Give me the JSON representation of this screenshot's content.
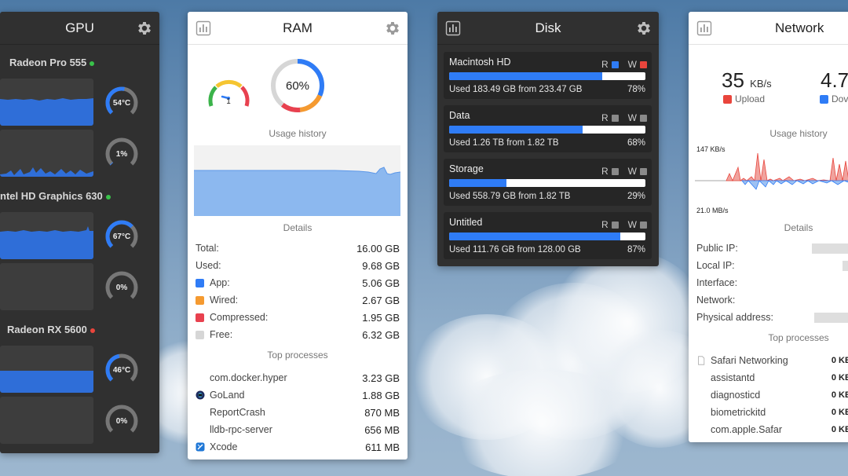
{
  "gpu": {
    "title": "GPU",
    "devices": [
      {
        "name": "Radeon Pro 555",
        "status_color": "#39c24a",
        "temp": "54°C",
        "usage": "1%",
        "temp_level": 0.54,
        "usage_level": 0.01
      },
      {
        "name": "ntel HD Graphics 630",
        "status_color": "#39c24a",
        "temp": "67°C",
        "usage": "0%",
        "temp_level": 0.67,
        "usage_level": 0.0
      },
      {
        "name": "Radeon RX 5600",
        "status_color": "#e9453c",
        "temp": "46°C",
        "usage": "0%",
        "temp_level": 0.46,
        "usage_level": 0.0
      }
    ]
  },
  "ram": {
    "title": "RAM",
    "pressure_value": "1",
    "usage_percent": "60%",
    "usage_level": 0.6,
    "history_title": "Usage history",
    "details_title": "Details",
    "details": [
      {
        "label": "Total:",
        "value": "16.00 GB"
      },
      {
        "label": "Used:",
        "value": "9.68 GB"
      },
      {
        "label": "App:",
        "value": "5.06 GB",
        "color": "#2f7cf6"
      },
      {
        "label": "Wired:",
        "value": "2.67 GB",
        "color": "#f59a30"
      },
      {
        "label": "Compressed:",
        "value": "1.95 GB",
        "color": "#e8414f"
      },
      {
        "label": "Free:",
        "value": "6.32 GB",
        "color": "#d6d6d6"
      }
    ],
    "processes_title": "Top processes",
    "processes": [
      {
        "name": "com.docker.hyper",
        "value": "3.23 GB",
        "icon": "blank"
      },
      {
        "name": "GoLand",
        "value": "1.88 GB",
        "icon": "goland-icon"
      },
      {
        "name": "ReportCrash",
        "value": "870 MB",
        "icon": "blank"
      },
      {
        "name": "lldb-rpc-server",
        "value": "656 MB",
        "icon": "blank"
      },
      {
        "name": "Xcode",
        "value": "611 MB",
        "icon": "xcode-icon"
      }
    ]
  },
  "disk": {
    "title": "Disk",
    "read_label": "R",
    "write_label": "W",
    "disks": [
      {
        "name": "Macintosh HD",
        "used": "Used 183.49 GB from 233.47 GB",
        "percent": "78%",
        "level": 0.78,
        "read_color": "#2f7cf6",
        "write_color": "#e9453c"
      },
      {
        "name": "Data",
        "used": "Used 1.26 TB from 1.82 TB",
        "percent": "68%",
        "level": 0.68,
        "read_color": "#8a8a8a",
        "write_color": "#8a8a8a"
      },
      {
        "name": "Storage",
        "used": "Used 558.79 GB from 1.82 TB",
        "percent": "29%",
        "level": 0.29,
        "read_color": "#8a8a8a",
        "write_color": "#8a8a8a"
      },
      {
        "name": "Untitled",
        "used": "Used 111.76 GB from 128.00 GB",
        "percent": "87%",
        "level": 0.87,
        "read_color": "#8a8a8a",
        "write_color": "#8a8a8a"
      }
    ]
  },
  "network": {
    "title": "Network",
    "upload_value": "35",
    "upload_unit": "KB/s",
    "upload_label": "Upload",
    "download_value": "4.7",
    "download_label": "Dov",
    "history_title": "Usage history",
    "history_top": "147 KB/s",
    "history_bottom": "21.0 MB/s",
    "details_title": "Details",
    "details": [
      "Public IP:",
      "Local IP:",
      "Interface:",
      "Network:",
      "Physical address:"
    ],
    "processes_title": "Top processes",
    "processes": [
      {
        "name": "Safari Networking",
        "value": "0 KB/"
      },
      {
        "name": "assistantd",
        "value": "0 KB/"
      },
      {
        "name": "diagnosticd",
        "value": "0 KB/"
      },
      {
        "name": "biometrickitd",
        "value": "0 KB/"
      },
      {
        "name": "com.apple.Safar",
        "value": "0 KB/"
      }
    ]
  }
}
